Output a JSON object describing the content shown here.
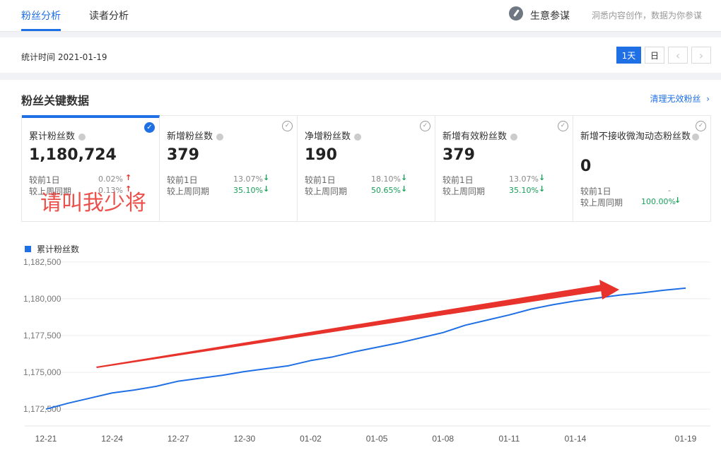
{
  "nav": {
    "tabs": [
      {
        "label": "粉丝分析"
      },
      {
        "label": "读者分析"
      }
    ]
  },
  "brand": {
    "name": "生意参谋",
    "slogan": "洞悉内容创作，数据为你参谋",
    "icon": "compass-icon"
  },
  "date_bar": {
    "stat_time": "统计时间 2021-01-19",
    "btn_1day": "1天",
    "btn_day": "日",
    "prev": "‹",
    "next": "›"
  },
  "section": {
    "title": "粉丝关键数据",
    "clean_link": "清理无效粉丝",
    "clean_chevron": "›"
  },
  "cards": [
    {
      "title": "累计粉丝数",
      "value": "1,180,724",
      "cmp1_label": "较前1日",
      "cmp1_val": "0.02%",
      "cmp1_dir": "↑",
      "cmp2_label": "较上周同期",
      "cmp2_val": "0.13%",
      "cmp2_dir": "↑",
      "check": "✓"
    },
    {
      "title": "新增粉丝数",
      "value": "379",
      "cmp1_label": "较前1日",
      "cmp1_val": "13.07%",
      "cmp1_dir": "↓",
      "cmp2_label": "较上周同期",
      "cmp2_val": "35.10%",
      "cmp2_dir": "↓",
      "check": "✓"
    },
    {
      "title": "净增粉丝数",
      "value": "190",
      "cmp1_label": "较前1日",
      "cmp1_val": "18.10%",
      "cmp1_dir": "↓",
      "cmp2_label": "较上周同期",
      "cmp2_val": "50.65%",
      "cmp2_dir": "↓",
      "check": "✓"
    },
    {
      "title": "新增有效粉丝数",
      "value": "379",
      "cmp1_label": "较前1日",
      "cmp1_val": "13.07%",
      "cmp1_dir": "↓",
      "cmp2_label": "较上周同期",
      "cmp2_val": "35.10%",
      "cmp2_dir": "↓",
      "check": "✓"
    },
    {
      "title": "新增不接收微淘动态粉丝数",
      "value": "0",
      "cmp1_label": "较前1日",
      "cmp1_val": "-",
      "cmp1_dir": "",
      "cmp2_label": "较上周同期",
      "cmp2_val": "100.00%",
      "cmp2_dir": "↓",
      "check": "✓"
    }
  ],
  "annotation": {
    "text": "请叫我少将"
  },
  "colors": {
    "accent": "#1f6fe5",
    "up": "#e8322c",
    "down": "#18a058",
    "annotation_arrow": "#e8322c"
  },
  "chart_data": {
    "type": "line",
    "legend": "累计粉丝数",
    "ylim": [
      1171500,
      1183500
    ],
    "yticks": [
      1172500,
      1175000,
      1177500,
      1180000,
      1182500
    ],
    "ytick_labels": [
      "1,172,500",
      "1,175,000",
      "1,177,500",
      "1,180,000",
      "1,182,500"
    ],
    "x": [
      "12-21",
      "12-22",
      "12-23",
      "12-24",
      "12-25",
      "12-26",
      "12-27",
      "12-28",
      "12-29",
      "12-30",
      "12-31",
      "01-01",
      "01-02",
      "01-03",
      "01-04",
      "01-05",
      "01-06",
      "01-07",
      "01-08",
      "01-09",
      "01-10",
      "01-11",
      "01-12",
      "01-13",
      "01-14",
      "01-15",
      "01-16",
      "01-17",
      "01-18",
      "01-19"
    ],
    "xtick_labels": [
      "12-21",
      "12-24",
      "12-27",
      "12-30",
      "01-02",
      "01-05",
      "01-08",
      "01-11",
      "01-14",
      "01-19"
    ],
    "series": [
      {
        "name": "累计粉丝数",
        "values": [
          1172500,
          1172900,
          1173250,
          1173600,
          1173800,
          1174050,
          1174400,
          1174600,
          1174800,
          1175050,
          1175250,
          1175450,
          1175800,
          1176050,
          1176400,
          1176700,
          1177000,
          1177350,
          1177700,
          1178200,
          1178550,
          1178900,
          1179300,
          1179600,
          1179850,
          1180050,
          1180250,
          1180400,
          1180580,
          1180724
        ]
      }
    ],
    "grid": true
  }
}
